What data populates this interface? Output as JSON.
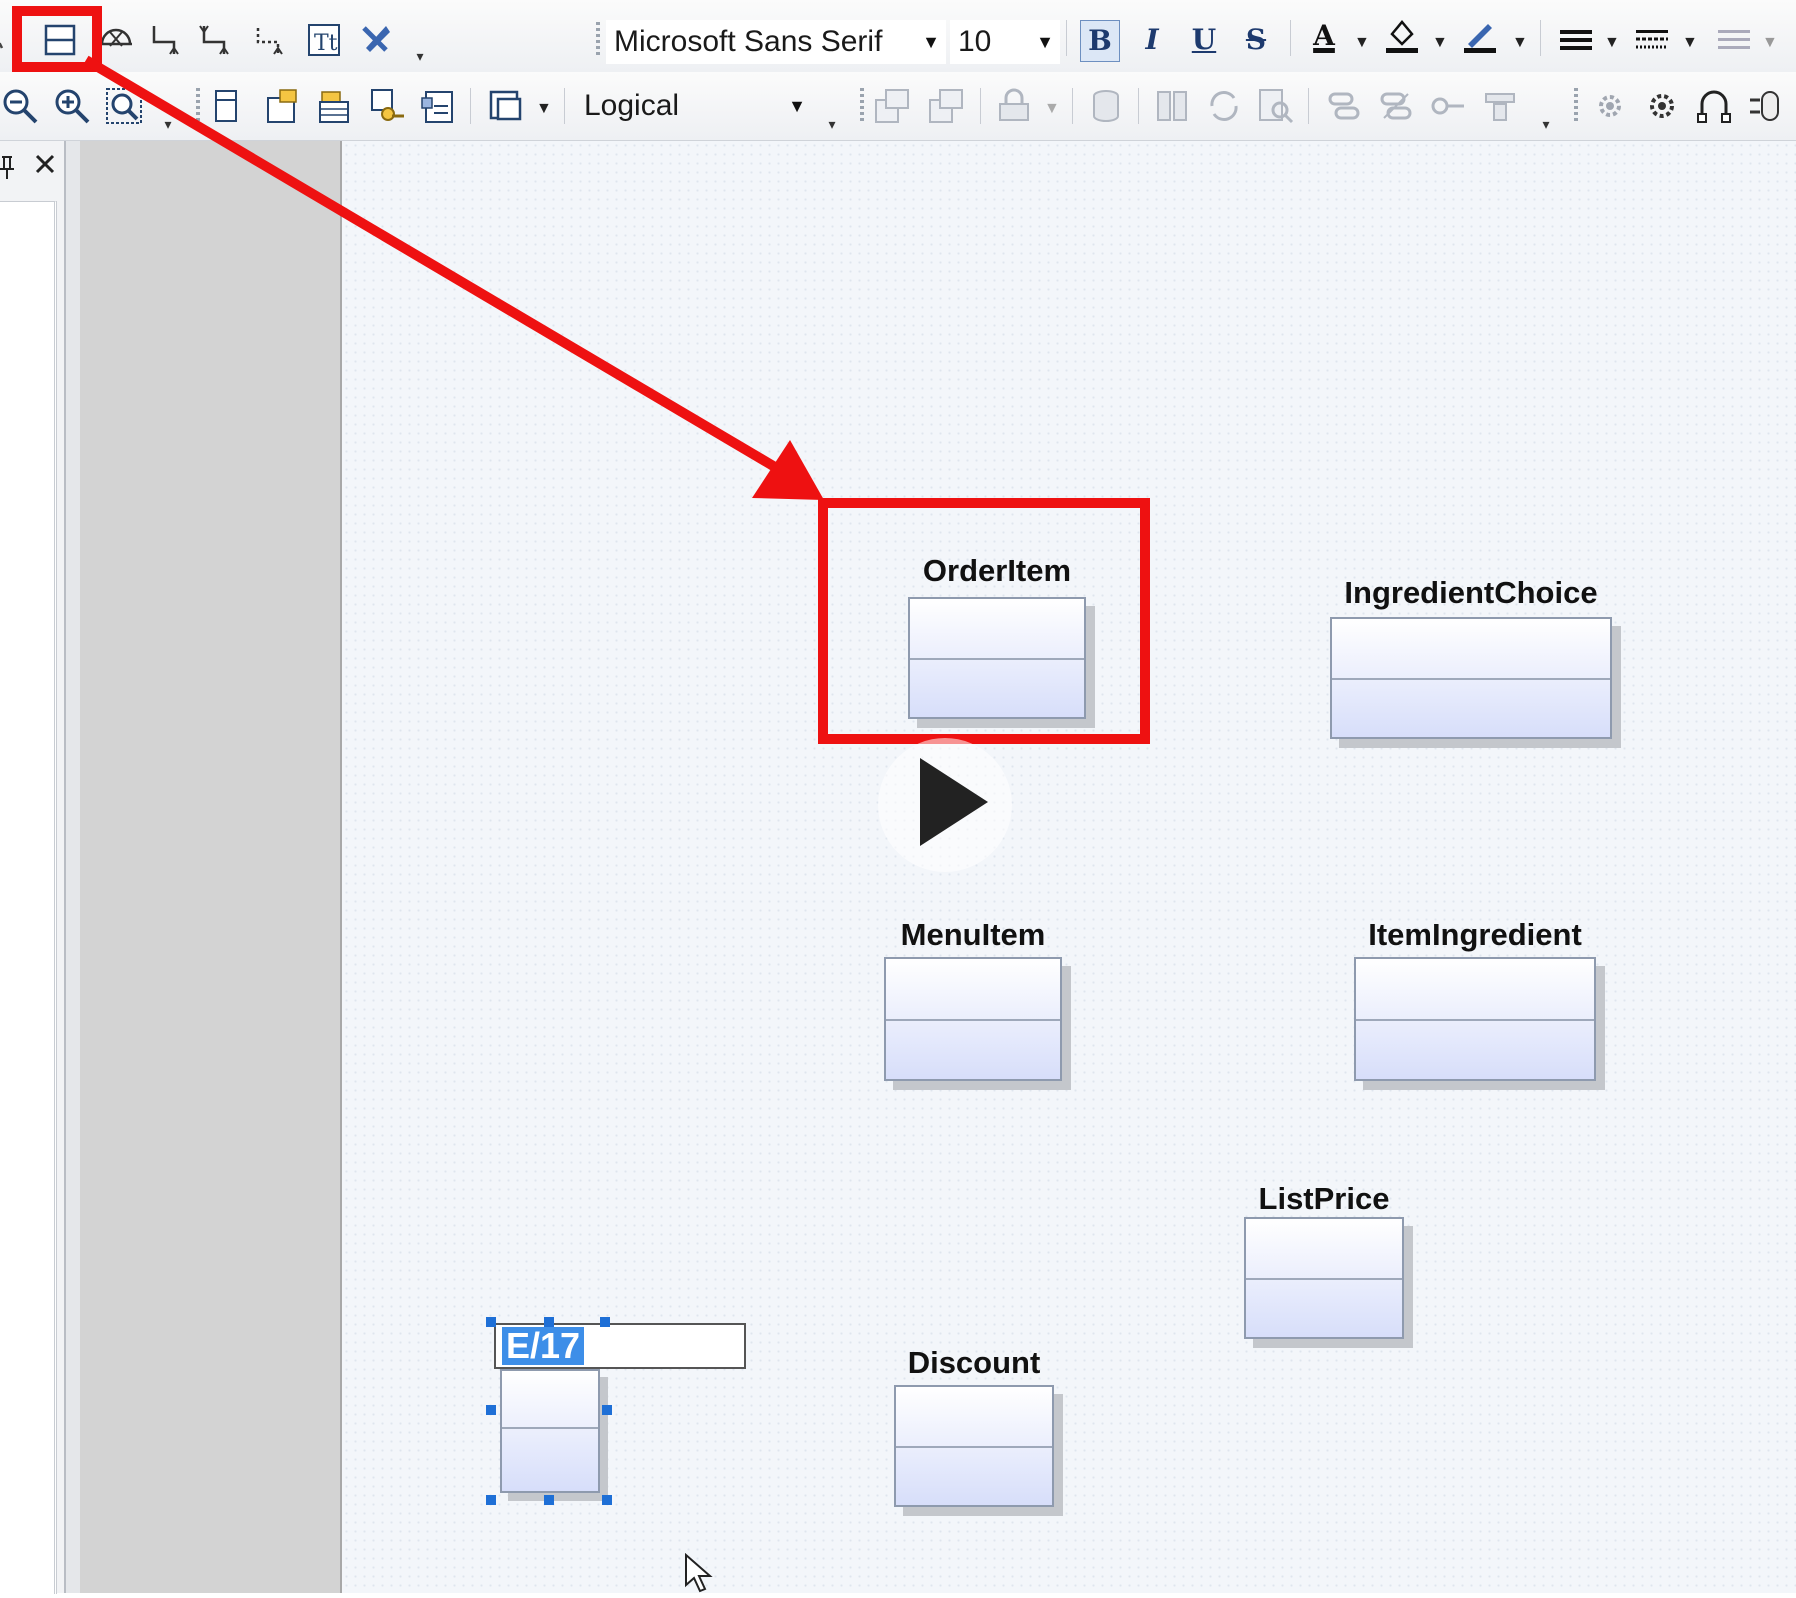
{
  "toolbar1": {
    "font_name": "Microsoft Sans Serif",
    "font_size": "10",
    "tools": [
      "lasso-icon",
      "entity-tool-icon",
      "inheritance-tool-icon",
      "relationship-tool-icon",
      "multi-relationship-tool-icon",
      "dotted-link-tool-icon",
      "text-tool-icon",
      "pin-tool-icon"
    ],
    "format": {
      "bold": "B",
      "italic": "I",
      "underline": "U",
      "strike": "S",
      "font_color": "A"
    }
  },
  "toolbar2": {
    "model_view": "Logical"
  },
  "diagram": {
    "entities": [
      {
        "id": "orderitem",
        "name": "OrderItem"
      },
      {
        "id": "ingredientchoice",
        "name": "IngredientChoice"
      },
      {
        "id": "menuitem",
        "name": "MenuItem"
      },
      {
        "id": "itemingredient",
        "name": "ItemIngredient"
      },
      {
        "id": "listprice",
        "name": "ListPrice"
      },
      {
        "id": "discount",
        "name": "Discount"
      }
    ],
    "editing_entity_name": "E/17"
  },
  "colors": {
    "highlight": "#ee1111",
    "entity_fill_top": "#ffffff",
    "entity_fill_bottom": "#d7defa",
    "selection": "#1e6fd6"
  },
  "panel": {
    "pin_icon": "pin-icon",
    "close_icon": "close-icon"
  }
}
